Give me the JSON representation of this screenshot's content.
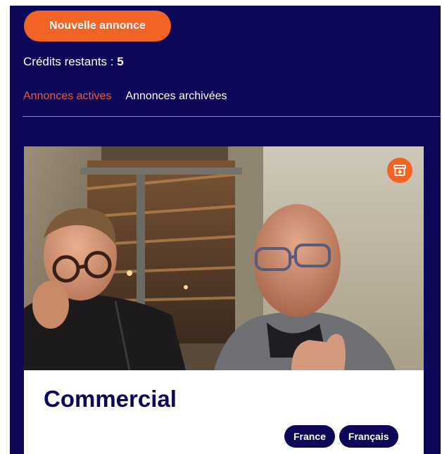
{
  "header": {
    "new_button_label": "Nouvelle annonce",
    "credits_label": "Crédits restants : ",
    "credits_value": "5"
  },
  "tabs": [
    {
      "label": "Annonces actives",
      "active": true
    },
    {
      "label": "Annonces archivées",
      "active": false
    }
  ],
  "card": {
    "title": "Commercial",
    "archive_icon": "archive-icon",
    "tags": [
      "France",
      "Français"
    ]
  },
  "colors": {
    "background": "#0d0759",
    "accent": "#f26326",
    "active_tab": "#ef5a3a",
    "card": "#ffffff"
  }
}
